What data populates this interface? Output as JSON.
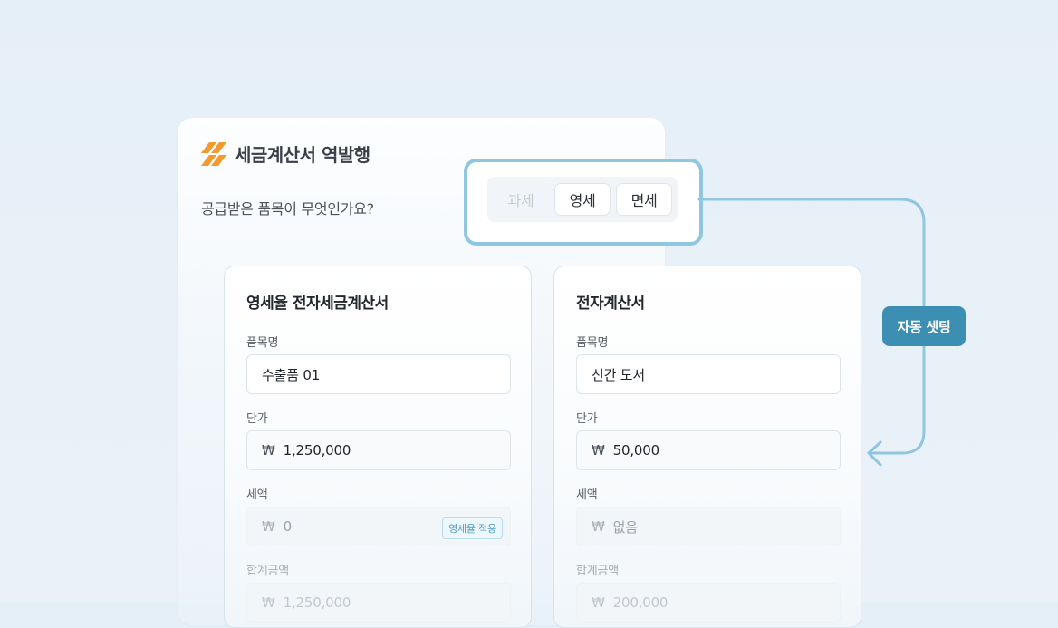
{
  "panel": {
    "title": "세금계산서 역발행",
    "question": "공급받은 품목이 무엇인가요?"
  },
  "tax_type": {
    "options": [
      "과세",
      "영세",
      "면세"
    ],
    "disabled_option": "과세"
  },
  "auto_badge": "자동 셋팅",
  "currency_symbol": "₩",
  "left_card": {
    "title": "영세율 전자세금계산서",
    "item_label": "품목명",
    "item_value": "수출품 01",
    "price_label": "단가",
    "price_value": "1,250,000",
    "tax_label": "세액",
    "tax_value": "0",
    "tax_tag": "영세율 적용",
    "total_label": "합계금액",
    "total_value": "1,250,000"
  },
  "right_card": {
    "title": "전자계산서",
    "item_label": "품목명",
    "item_value": "신간 도서",
    "price_label": "단가",
    "price_value": "50,000",
    "tax_label": "세액",
    "tax_value": "없음",
    "total_label": "합계금액",
    "total_value": "200,000"
  },
  "colors": {
    "accent": "#3c8fb3",
    "highlight_border": "#8fc7e0",
    "logo": "#f59a2a"
  }
}
